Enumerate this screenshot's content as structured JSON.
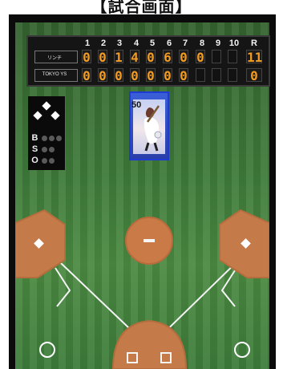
{
  "screen_title": "【試合画面】",
  "scoreboard": {
    "innings": [
      "1",
      "2",
      "3",
      "4",
      "5",
      "6",
      "7",
      "8",
      "9",
      "10"
    ],
    "runs_header": "R",
    "teams": [
      {
        "name": "リンチ",
        "innings": [
          "0",
          "0",
          "1",
          "4",
          "0",
          "6",
          "0",
          "0",
          "",
          ""
        ],
        "total": "11"
      },
      {
        "name": "TOKYO YS",
        "innings": [
          "0",
          "0",
          "0",
          "0",
          "0",
          "0",
          "0",
          "",
          "",
          ""
        ],
        "total": "0"
      }
    ]
  },
  "count": {
    "balls_label": "B",
    "strikes_label": "S",
    "outs_label": "O",
    "balls": 0,
    "strikes": 0,
    "outs": 0
  },
  "bases": {
    "first": true,
    "second": true,
    "third": true
  },
  "batter_card": {
    "number": "50",
    "name": "",
    "caption": ""
  },
  "colors": {
    "scoreboard_digit": "#f29b22",
    "card_border": "#1e3ad0",
    "grass": "#3f7b3a",
    "dirt": "#c47a49"
  },
  "icons": {
    "bases": "base-diamond-icon"
  }
}
